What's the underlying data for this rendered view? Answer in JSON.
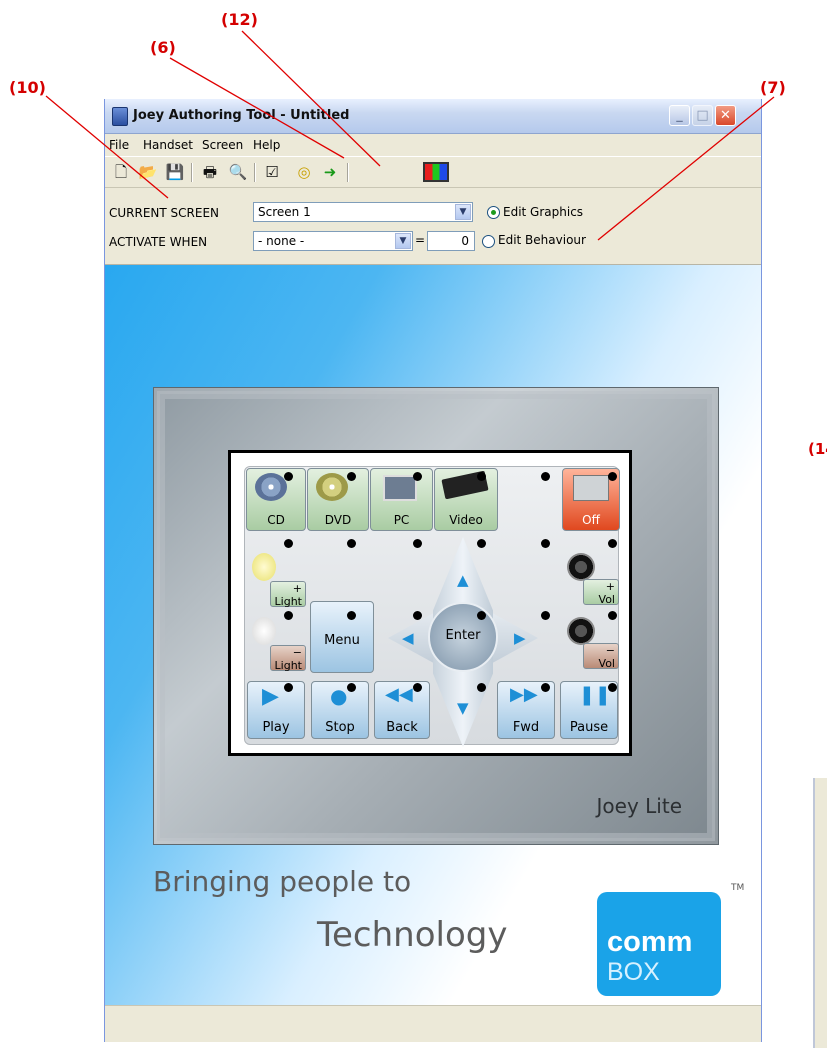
{
  "callouts": [
    {
      "id": "10",
      "label": "(10)"
    },
    {
      "id": "6",
      "label": "(6)"
    },
    {
      "id": "12",
      "label": "(12)"
    },
    {
      "id": "7",
      "label": "(7)"
    },
    {
      "id": "14",
      "label": "(14"
    }
  ],
  "window": {
    "title": "Joey Authoring Tool - Untitled",
    "min_label": "_",
    "max_label": "□",
    "close_label": "✕"
  },
  "menu": [
    "File",
    "Handset",
    "Screen",
    "Help"
  ],
  "toolbar": {
    "icons": [
      "new-icon",
      "open-icon",
      "save-icon",
      "print-icon",
      "print-preview-icon",
      "checkbox-tool-icon",
      "target-tool-icon",
      "send-to-handset-icon",
      "color-palette-icon"
    ],
    "glyphs": {
      "new": "🗋",
      "open": "📂",
      "save": "💾",
      "print": "🖶",
      "preview": "🔍",
      "check": "☑",
      "target": "◎",
      "send": "➜",
      "palette": "▮"
    }
  },
  "current_screen": {
    "label": "CURRENT SCREEN",
    "value": "Screen 1"
  },
  "activate_when": {
    "label": "ACTIVATE WHEN",
    "value": "- none -",
    "equals": "=",
    "number": "0"
  },
  "mode": {
    "edit_graphics": "Edit Graphics",
    "edit_behaviour": "Edit Behaviour",
    "selected": "edit_graphics"
  },
  "handset": {
    "brand": "Joey Lite",
    "buttons": {
      "cd": "CD",
      "dvd": "DVD",
      "pc": "PC",
      "video": "Video",
      "off": "Off",
      "light_up": "Light",
      "light_down": "Light",
      "menu": "Menu",
      "enter": "Enter",
      "vol_up": "Vol",
      "vol_down": "Vol",
      "play": "Play",
      "stop": "Stop",
      "back": "Back",
      "fwd": "Fwd",
      "pause": "Pause"
    },
    "plus": "+",
    "minus": "−"
  },
  "slogan": {
    "line1": "Bringing people to",
    "line2": "Technology"
  },
  "logo": {
    "top": "comm",
    "bottom": "BOX",
    "tm": "TM"
  }
}
